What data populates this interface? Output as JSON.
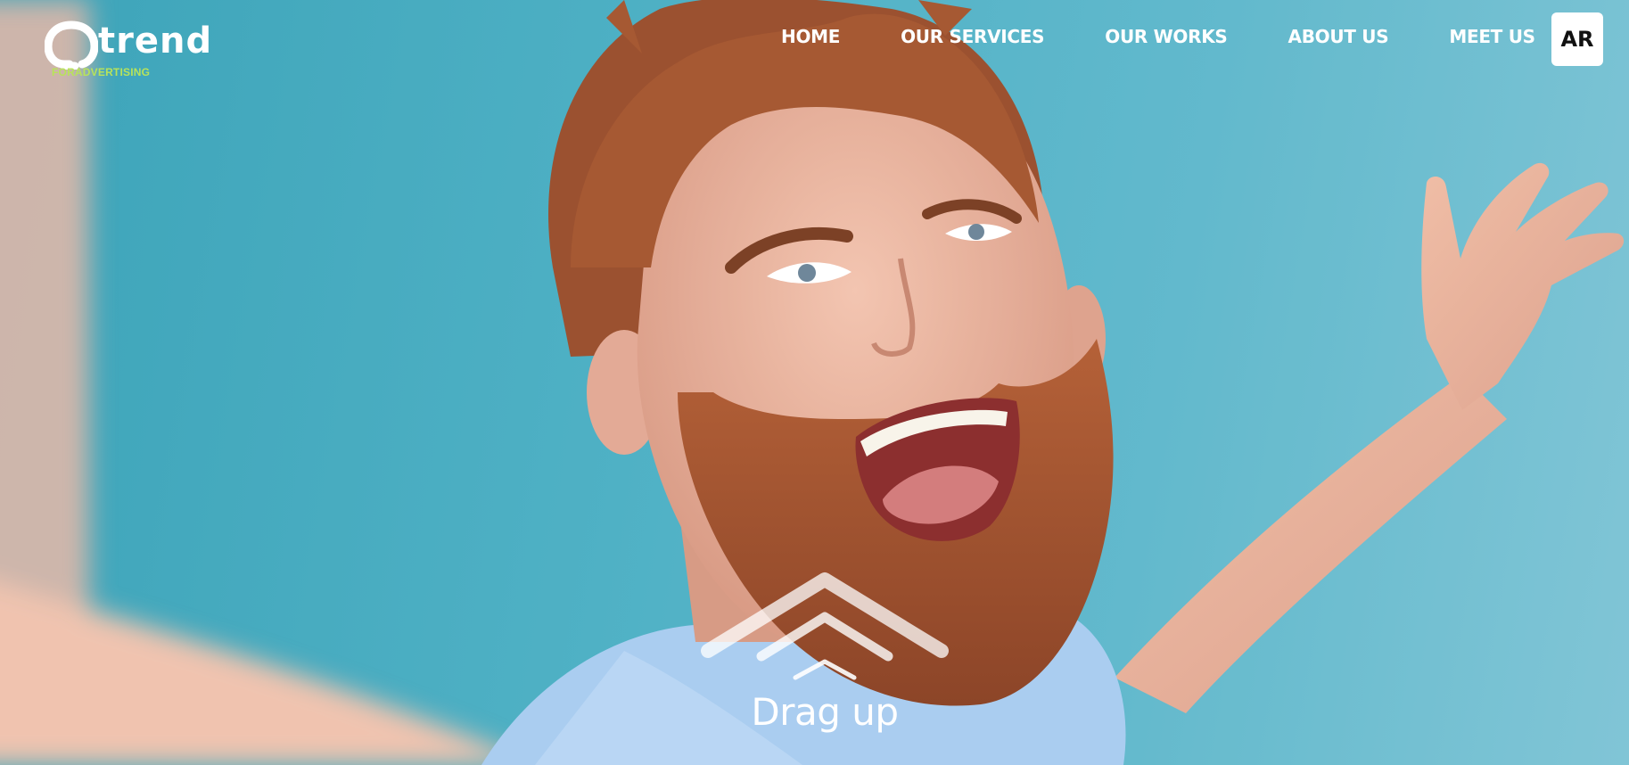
{
  "brand": {
    "name": "trend",
    "tagline": "FORADVERTISING",
    "tagline_color": "#b8e35a"
  },
  "nav": {
    "items": [
      {
        "label": "HOME"
      },
      {
        "label": "OUR SERVICES"
      },
      {
        "label": "OUR WORKS"
      },
      {
        "label": "ABOUT US"
      },
      {
        "label": "MEET US"
      }
    ],
    "language_button": "AR"
  },
  "hero": {
    "background_color": "#4cb0c4",
    "image_description_icon": "hero-photo",
    "drag_label": "Drag up",
    "drag_icon": "chevrons-up-icon"
  }
}
